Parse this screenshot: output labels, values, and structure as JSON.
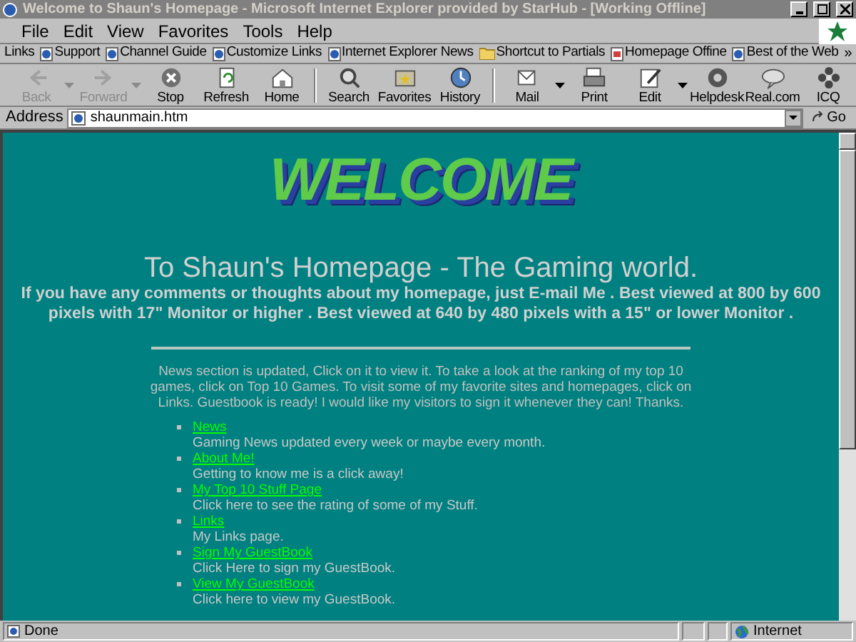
{
  "window": {
    "title": "Welcome to Shaun's Homepage - Microsoft Internet Explorer provided by StarHub - [Working Offline]"
  },
  "menu": [
    "File",
    "Edit",
    "View",
    "Favorites",
    "Tools",
    "Help"
  ],
  "links_bar": {
    "label": "Links",
    "items": [
      {
        "label": "Support",
        "kind": "page"
      },
      {
        "label": "Channel Guide",
        "kind": "page"
      },
      {
        "label": "Customize Links",
        "kind": "page"
      },
      {
        "label": "Internet Explorer News",
        "kind": "page"
      },
      {
        "label": "Shortcut to Partials",
        "kind": "folder"
      },
      {
        "label": "Homepage Offine",
        "kind": "image"
      },
      {
        "label": "Best of the Web",
        "kind": "page"
      }
    ],
    "more": "»"
  },
  "toolbar": [
    {
      "label": "Back",
      "disabled": true,
      "dropdown": true
    },
    {
      "label": "Forward",
      "disabled": true,
      "dropdown": true
    },
    {
      "label": "Stop",
      "disabled": false,
      "dropdown": false
    },
    {
      "label": "Refresh",
      "disabled": false,
      "dropdown": false
    },
    {
      "label": "Home",
      "disabled": false,
      "dropdown": false
    },
    {
      "label": "Search",
      "disabled": false,
      "dropdown": false
    },
    {
      "label": "Favorites",
      "disabled": false,
      "dropdown": false
    },
    {
      "label": "History",
      "disabled": false,
      "dropdown": false
    },
    {
      "label": "Mail",
      "disabled": false,
      "dropdown": true
    },
    {
      "label": "Print",
      "disabled": false,
      "dropdown": false
    },
    {
      "label": "Edit",
      "disabled": false,
      "dropdown": true
    },
    {
      "label": "Helpdesk",
      "disabled": false,
      "dropdown": false
    },
    {
      "label": "Real.com",
      "disabled": false,
      "dropdown": false
    },
    {
      "label": "ICQ",
      "disabled": false,
      "dropdown": false
    }
  ],
  "address": {
    "label": "Address",
    "value": "shaunmain.htm",
    "go": "Go"
  },
  "page": {
    "logo": "WELCOME",
    "heading": "To Shaun's Homepage - The Gaming world.",
    "subheading": "If you have any comments or thoughts about my homepage, just E-mail Me . Best viewed at 800 by 600 pixels with 17\" Monitor or higher . Best viewed at 640 by 480 pixels with a 15\" or lower Monitor .",
    "intro": "News section is updated, Click on it to view it. To take a look at the ranking of my top 10 games, click on Top 10 Games. To visit some of my favorite sites and homepages, click on Links. Guestbook is ready! I would like my visitors to sign it whenever they can! Thanks.",
    "items": [
      {
        "link": "News",
        "description": "Gaming News updated every week or maybe every month."
      },
      {
        "link": "About Me!",
        "description": "Getting to know me is a click away!"
      },
      {
        "link": "My Top 10 Stuff Page",
        "description": "Click here to see the rating of some of my Stuff."
      },
      {
        "link": "Links",
        "description": "My Links page."
      },
      {
        "link": "Sign My GuestBook",
        "description": "Click Here to sign my GuestBook."
      },
      {
        "link": "View My GuestBook",
        "description": "Click here to view my GuestBook."
      }
    ]
  },
  "status_bar": {
    "text": "Done",
    "zone": "Internet"
  }
}
